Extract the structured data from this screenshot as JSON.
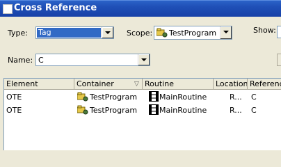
{
  "window": {
    "title": "Cross Reference"
  },
  "filters": {
    "type_label": "Type:",
    "type_value": "Tag",
    "scope_label": "Scope:",
    "scope_value": "TestProgram",
    "show_label": "Show:",
    "name_label": "Name:",
    "name_value": "C"
  },
  "table": {
    "columns": [
      "Element",
      "Container",
      "Routine",
      "Location",
      "Reference"
    ],
    "rows": [
      {
        "element": "OTE",
        "container": "TestProgram",
        "routine": "MainRoutine",
        "location": "R...",
        "reference": "C"
      },
      {
        "element": "OTE",
        "container": "TestProgram",
        "routine": "MainRoutine",
        "location": "R...",
        "reference": "C"
      }
    ]
  },
  "icons": {
    "title": "window-icon",
    "program": "program-icon",
    "routine": "ladder-routine-icon",
    "sort": "sort-down-icon"
  }
}
